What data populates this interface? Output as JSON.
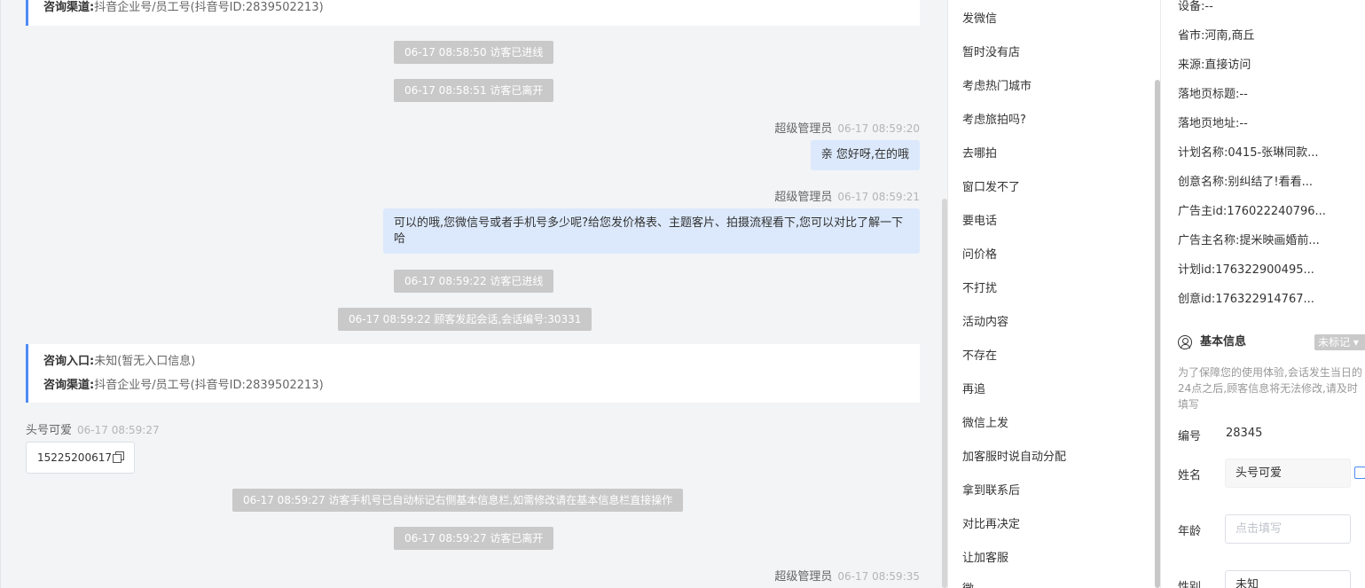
{
  "chat": {
    "top_card": {
      "channel_label": "咨询渠道:",
      "channel_value": "抖音企业号/员工号(抖音号ID:2839502213)"
    },
    "sys1": "06-17 08:58:50 访客已进线",
    "sys2": "06-17 08:58:51 访客已离开",
    "msg1": {
      "sender": "超级管理员",
      "time": "06-17 08:59:20",
      "text": "亲 您好呀,在的哦"
    },
    "msg2": {
      "sender": "超级管理员",
      "time": "06-17 08:59:21",
      "text": "可以的哦,您微信号或者手机号多少呢?给您发价格表、主题客片、拍摄流程看下,您可以对比了解一下哈"
    },
    "sys3": "06-17 08:59:22 访客已进线",
    "sys4": "06-17 08:59:22 顾客发起会话,会话编号:30331",
    "card2": {
      "entry_label": "咨询入口:",
      "entry_value": "未知(暂无入口信息)",
      "channel_label": "咨询渠道:",
      "channel_value": "抖音企业号/员工号(抖音号ID:2839502213)"
    },
    "msg3": {
      "sender": "头号可爱",
      "time": "06-17 08:59:27",
      "text": "15225200617"
    },
    "sys5": "06-17 08:59:27 访客手机号已自动标记右侧基本信息栏,如需修改请在基本信息栏直接操作",
    "sys6": "06-17 08:59:27 访客已离开",
    "msg4": {
      "sender": "超级管理员",
      "time": "06-17 08:59:35"
    }
  },
  "quick_replies": [
    "发微信",
    "暂时没有店",
    "考虑热门城市",
    "考虑旅拍吗?",
    "去哪拍",
    "窗口发不了",
    "要电话",
    "问价格",
    "不打扰",
    "活动内容",
    "不存在",
    "再追",
    "微信上发",
    "加客服时说自动分配",
    "拿到联系后",
    "对比再决定",
    "让加客服",
    "微"
  ],
  "info": {
    "device": "设备:--",
    "province": "省市:河南,商丘",
    "source": "来源:直接访问",
    "landing_title": "落地页标题:--",
    "landing_url": "落地页地址:--",
    "plan_name": "计划名称:0415-张琳同款...",
    "creative_name": "创意名称:别纠结了!看看...",
    "advertiser_id": "广告主id:176022240796...",
    "advertiser_name": "广告主名称:提米映画婚前...",
    "plan_id": "计划id:176322900495...",
    "creative_id": "创意id:176322914767...",
    "basic_title": "基本信息",
    "mark_tag": "未标记 ▾",
    "note": "为了保障您的使用体验,会话发生当日的24点之后,顾客信息将无法修改,请及时填写",
    "no_label": "编号",
    "no_value": "28345",
    "name_label": "姓名",
    "name_value": "头号可爱",
    "age_label": "年龄",
    "age_placeholder": "点击填写",
    "gender_label": "性别",
    "gender_value": "未知"
  },
  "colors": {
    "accent": "#4d8bf5",
    "bubble_out": "#dce9fc",
    "system_pill": "#c9c9c9"
  }
}
